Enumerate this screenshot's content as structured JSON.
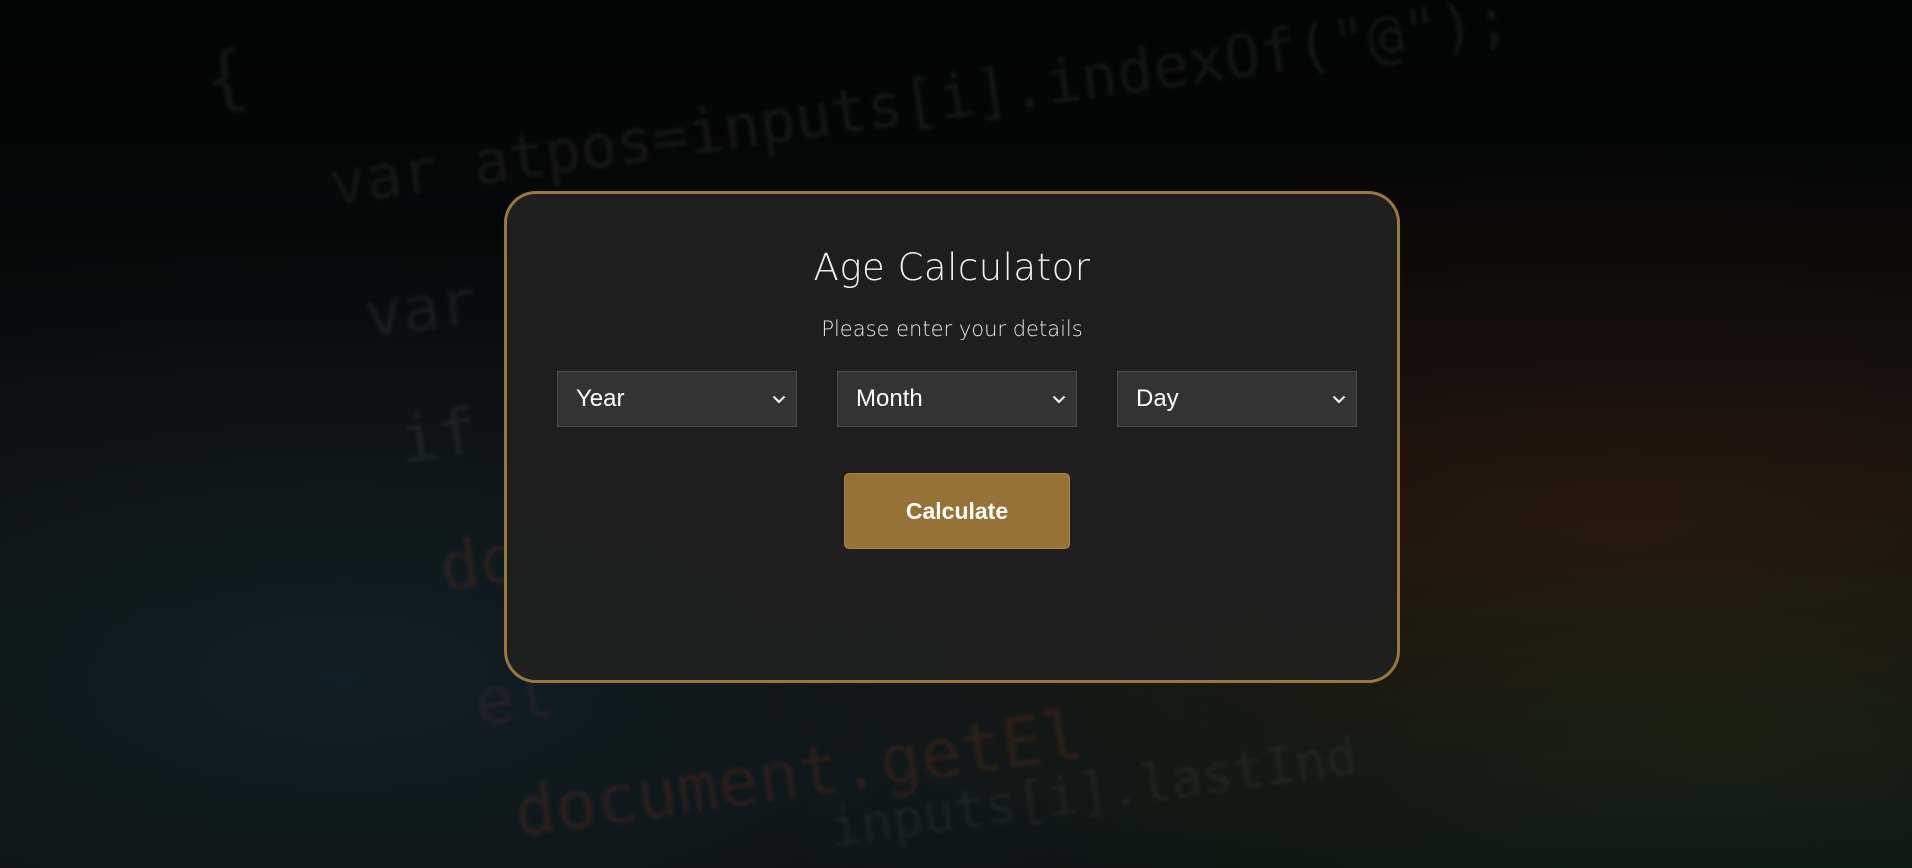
{
  "background": {
    "code_lines": [
      "{",
      "var atpos=inputs[i].indexOf(\"@\");",
      "var",
      "if",
      "do",
      "el",
      "document.getEl",
      "inputs[i].lastInd"
    ]
  },
  "card": {
    "title": "Age Calculator",
    "subtitle": "Please enter your details",
    "selects": {
      "year": "Year",
      "month": "Month",
      "day": "Day"
    },
    "button_label": "Calculate"
  },
  "colors": {
    "accent": "#967238",
    "border": "#9b7740",
    "card_bg": "#1f1f1f",
    "select_bg": "#333333"
  }
}
